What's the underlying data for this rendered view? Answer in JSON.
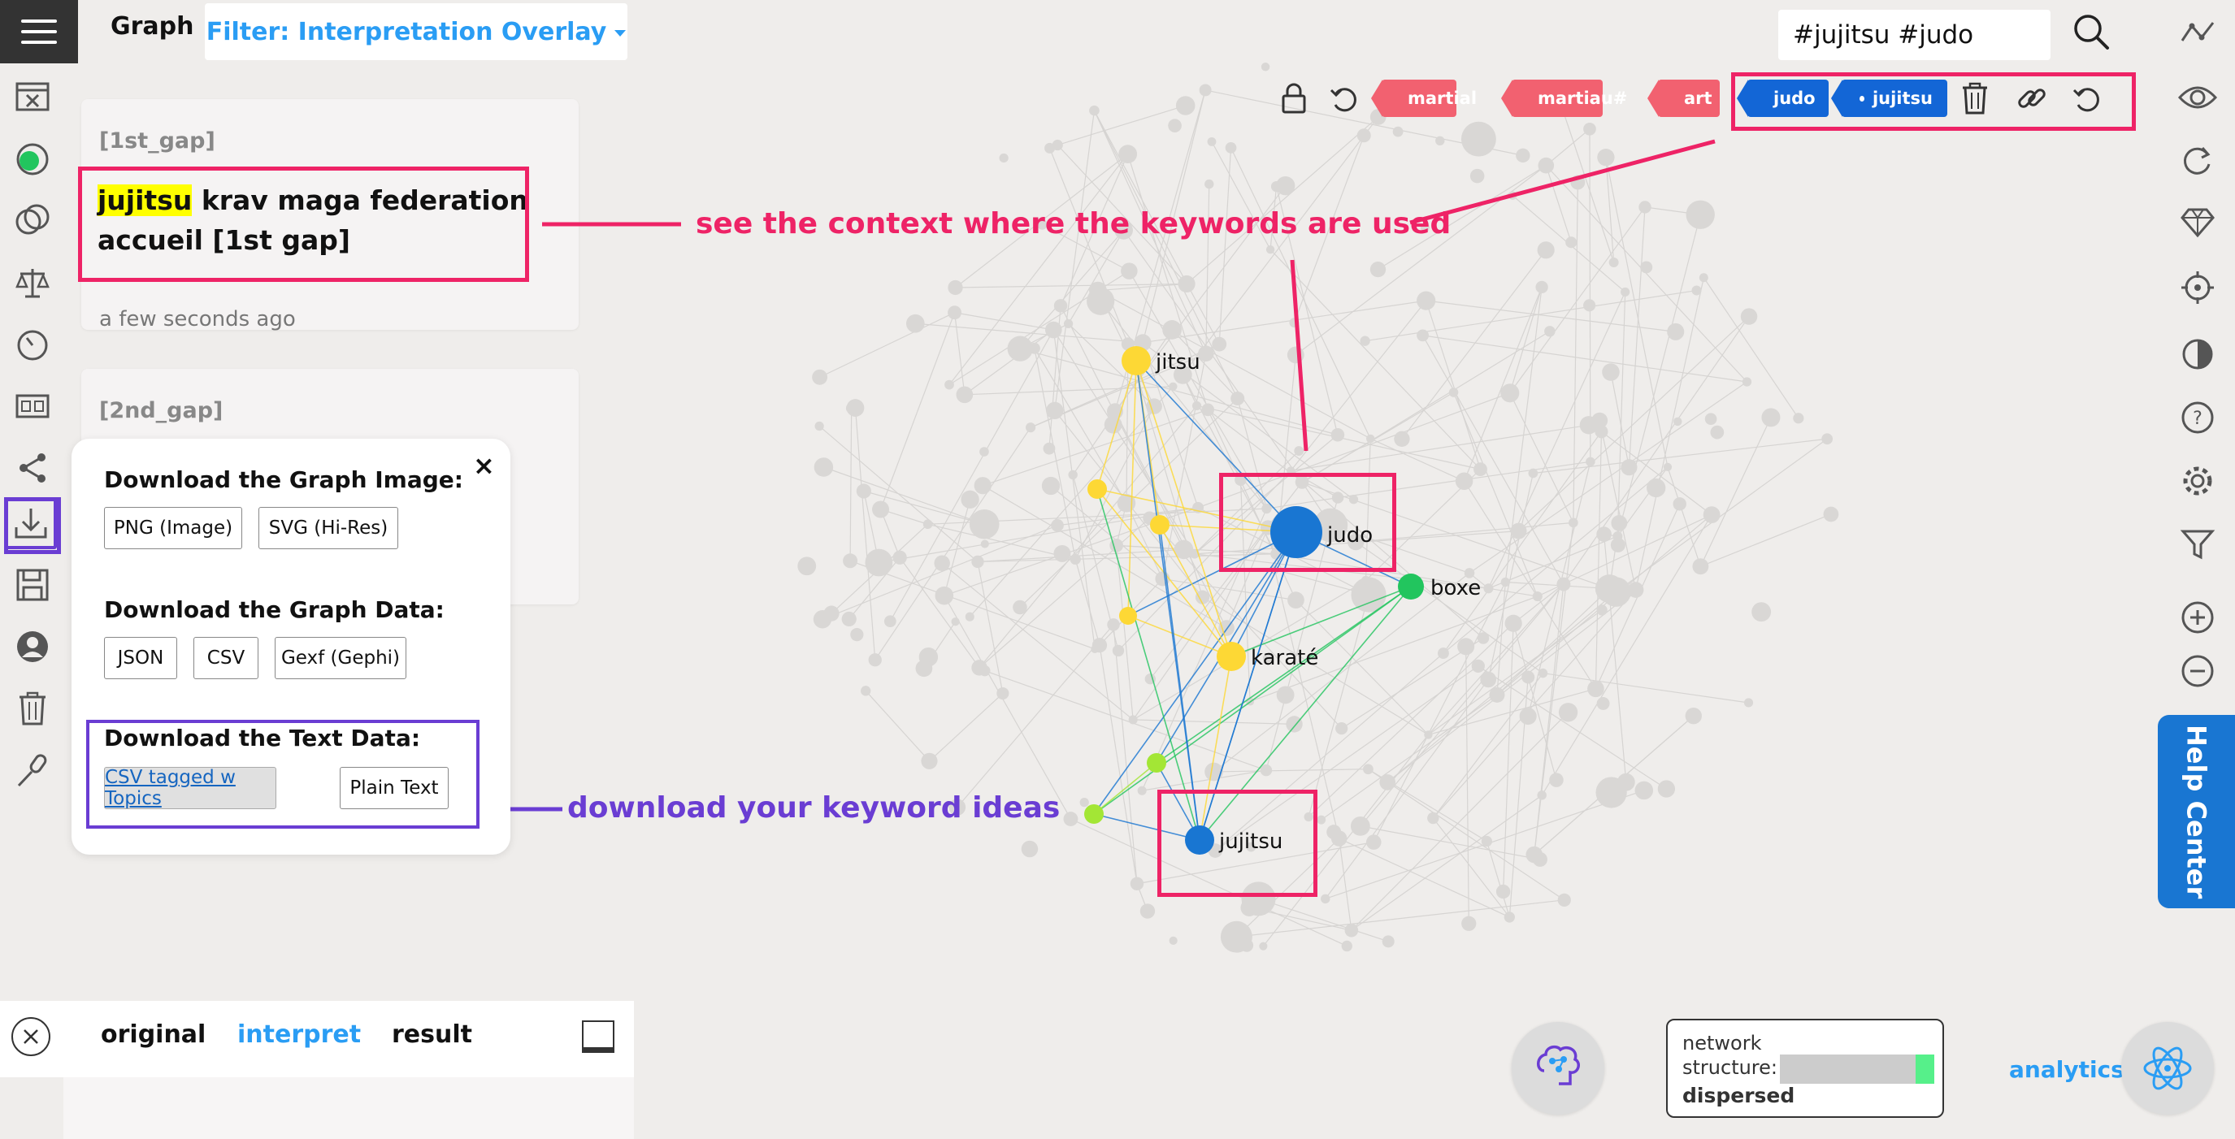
{
  "header": {
    "title": "Graph",
    "filter_label": "Filter: Interpretation Overlay",
    "search_value": "#jujitsu #judo"
  },
  "cards": [
    {
      "label": "[1st_gap]",
      "highlight": "jujitsu",
      "text": " krav maga federation accueil [1st gap]",
      "time": "a few seconds ago"
    },
    {
      "label": "[2nd_gap]"
    }
  ],
  "download_popup": {
    "close": "×",
    "image_heading": "Download the Graph Image:",
    "image_buttons": [
      "PNG (Image)",
      "SVG (Hi-Res)"
    ],
    "data_heading": "Download the Graph Data:",
    "data_buttons": [
      "JSON",
      "CSV",
      "Gexf (Gephi)"
    ],
    "text_heading": "Download the Text Data:",
    "text_buttons": [
      "CSV tagged w Topics",
      "Plain Text"
    ]
  },
  "annotations": {
    "context": "see the context where the keywords are used",
    "download": "download your keyword ideas"
  },
  "toolbar": {
    "tags_red": [
      "martial",
      "martiau#",
      "art"
    ],
    "tags_blue": [
      "judo",
      "jujitsu"
    ]
  },
  "graph_nodes": [
    {
      "label": "jitsu",
      "color": "#fdd835"
    },
    {
      "label": "judo",
      "color": "#1976d2"
    },
    {
      "label": "boxe",
      "color": "#22c55e"
    },
    {
      "label": "karaté",
      "color": "#fdd835"
    },
    {
      "label": "jujitsu",
      "color": "#1976d2"
    }
  ],
  "help_center": "Help Center",
  "bottom_panel": {
    "tabs": [
      "original",
      "interpret",
      "result"
    ],
    "active_tab": "interpret"
  },
  "network_structure": {
    "line1": "network",
    "line2": "structure:",
    "value": "dispersed",
    "accent": "#56f08a",
    "level": 0.12
  },
  "analytics": "analytics"
}
